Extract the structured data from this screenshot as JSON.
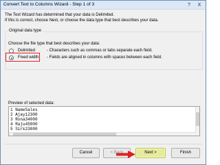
{
  "window": {
    "title": "Convert Text to Columns Wizard - Step 1 of 3",
    "help_label": "?",
    "close_label": "X"
  },
  "intro": {
    "line1": "The Text Wizard has determined that your data is Delimited.",
    "line2": "If this is correct, choose Next, or choose the data type that best describes your data."
  },
  "original_data_type": {
    "group_title": "Original data type",
    "choose_label": "Choose the file type that best describes your data:",
    "options": [
      {
        "label": "Delimited",
        "description": "- Characters such as commas or tabs separate each field.",
        "selected": false
      },
      {
        "label": "Fixed width",
        "description": "- Fields are aligned in columns with spaces between each field.",
        "selected": true
      }
    ]
  },
  "preview": {
    "label": "Preview of selected data:",
    "lines": [
      "1 NameSales",
      "2 Ajay12300",
      "3 Rona34000",
      "4 Raju45000",
      "5 Sirk23000"
    ]
  },
  "buttons": {
    "cancel": "Cancel",
    "back": "< Back",
    "next": "Next >",
    "finish": "Finish"
  },
  "colors": {
    "highlight_box": "#e02020",
    "arrow": "#e02020",
    "next_button_highlight": "#e6eaa0"
  },
  "icons": {
    "help": "help-icon",
    "close": "close-icon",
    "annotation_arrow": "red-arrow-icon"
  }
}
